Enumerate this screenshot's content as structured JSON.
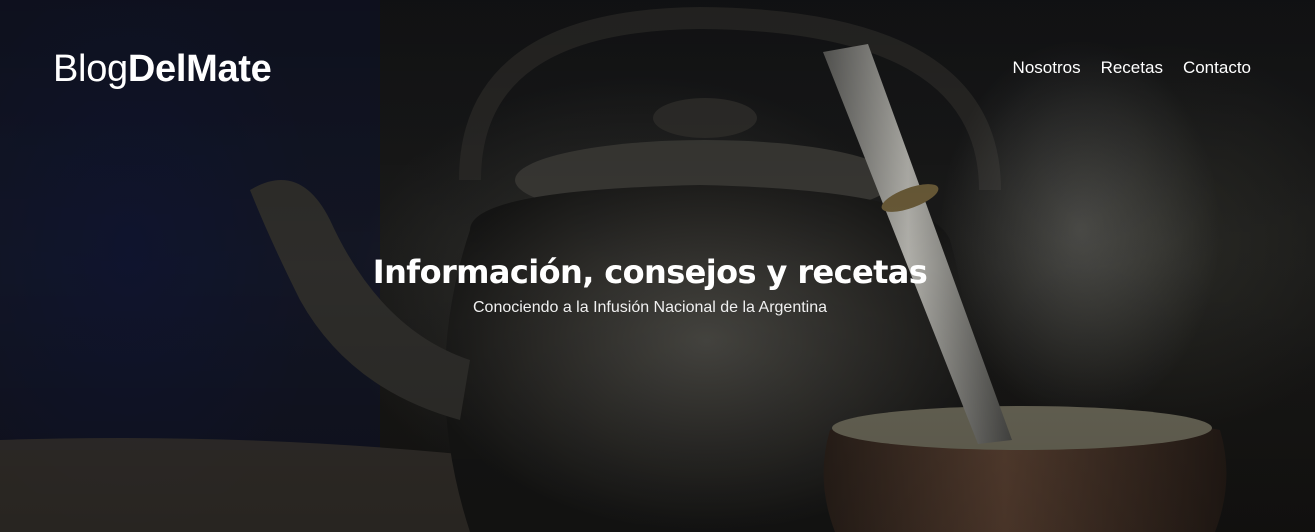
{
  "brand": {
    "light": "Blog",
    "bold": "DelMate"
  },
  "nav": {
    "items": [
      {
        "label": "Nosotros"
      },
      {
        "label": "Recetas"
      },
      {
        "label": "Contacto"
      }
    ]
  },
  "hero": {
    "title": "Información, consejos y recetas",
    "subtitle": "Conociendo a la Infusión Nacional de la Argentina",
    "image_subject": "kettle and mate gourd with bombilla, steam"
  },
  "colors": {
    "text": "#ffffff",
    "background_dark": "#141517",
    "accent_blue": "#121834"
  }
}
